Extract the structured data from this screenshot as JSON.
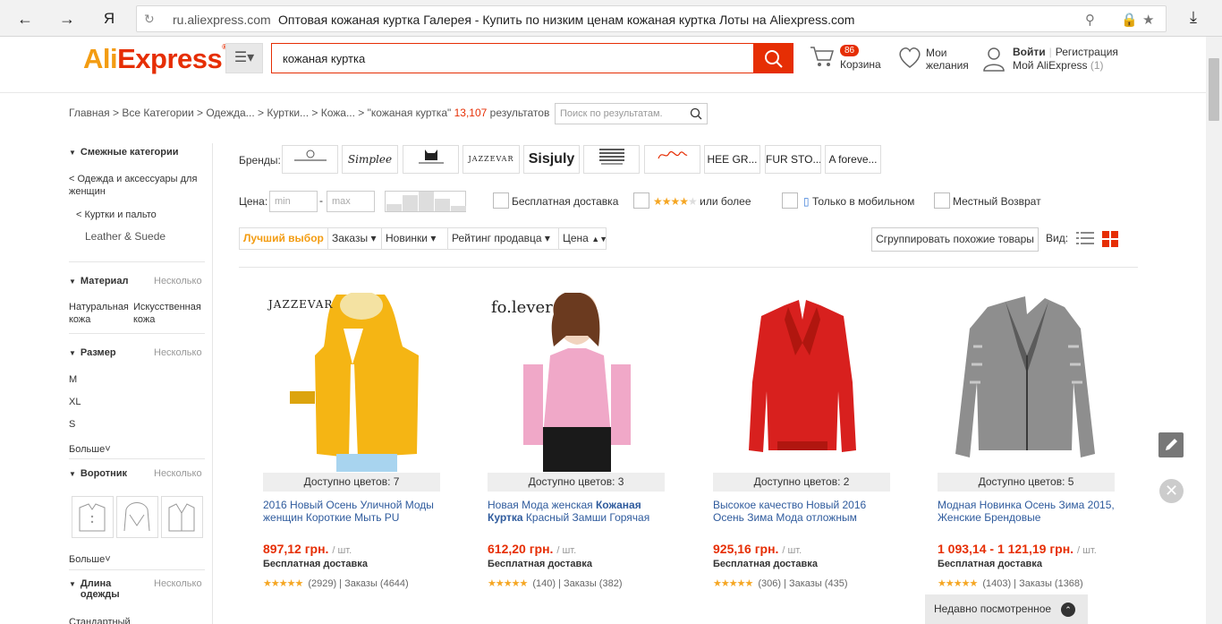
{
  "browser": {
    "domain": "ru.aliexpress.com",
    "title": "Оптовая кожаная куртка Галерея - Купить по низким ценам кожаная куртка Лоты на Aliexpress.com",
    "logo_letter": "Я"
  },
  "header": {
    "logo_ali": "Ali",
    "logo_express": "Express",
    "logo_tm": "®",
    "search_value": "кожаная куртка",
    "cart_count": "86",
    "cart_label": "Корзина",
    "wish_line1": "Мои",
    "wish_line2": "желания",
    "signin": "Войти",
    "register": "Регистрация",
    "my_account": "Мой AliExpress",
    "my_account_count": "(1)"
  },
  "breadcrumb": {
    "path": "Главная > Все Категории > Одежда... > Куртки... > Кожа... > \"кожаная куртка\"",
    "count": "13,107",
    "suffix": "результатов",
    "search_placeholder": "Поиск по результатам."
  },
  "sidebar": {
    "related_title": "Смежные категории",
    "cat1": "< Одежда и аксессуары для женщин",
    "cat2": "< Куртки и пальто",
    "cat3": "Leather & Suede",
    "material_title": "Материал",
    "material_sub": "Несколько",
    "material_opt1": "Натуральная кожа",
    "material_opt2": "Искусственная кожа",
    "size_title": "Размер",
    "size_sub": "Несколько",
    "sizes": [
      "M",
      "XL",
      "S"
    ],
    "more1": "Больше",
    "collar_title": "Воротник",
    "collar_sub": "Несколько",
    "more2": "Больше",
    "length_title": "Длина одежды",
    "length_sub": "Несколько",
    "length_opt1": "Стандартный"
  },
  "filters": {
    "brands_label": "Бренды:",
    "brands": [
      "",
      "Simplee",
      "",
      "JAZZEVAR",
      "Sisjuly",
      "",
      "",
      "HEE GR...",
      "FUR STO...",
      "A foreve..."
    ],
    "price_label": "Цена:",
    "price_min": "min",
    "price_max": "max",
    "dash": "-",
    "free_shipping": "Бесплатная доставка",
    "rating_or_more": "или более",
    "mobile_only": "Только в мобильном",
    "local_return": "Местный Возврат"
  },
  "sort": {
    "best": "Лучший выбор",
    "orders": "Заказы",
    "new": "Новинки",
    "seller_rating": "Рейтинг продавца",
    "price": "Цена",
    "group": "Сгруппировать похожие товары",
    "view": "Вид:"
  },
  "products": [
    {
      "brand": "JAZZEVAR",
      "colors": "Доступно цветов: 7",
      "title": "2016 Новый Осень Уличной Моды женщин Короткие Мыть PU",
      "title_bold": "",
      "title_rest": "",
      "price": "897,12 грн.",
      "unit": "/ шт.",
      "shipping": "Бесплатная доставка",
      "reviews": "(2929)",
      "orders": "Заказы (4644)",
      "color": "#f5b514"
    },
    {
      "brand": "fo.lever",
      "colors": "Доступно цветов: 3",
      "title": "Новая Мода женская ",
      "title_bold": "Кожаная Куртка",
      "title_rest": " Красный Замши Горячая",
      "price": "612,20 грн.",
      "unit": "/ шт.",
      "shipping": "Бесплатная доставка",
      "reviews": "(140)",
      "orders": "Заказы (382)",
      "color": "#f0a8c8"
    },
    {
      "brand": "",
      "colors": "Доступно цветов: 2",
      "title": "Высокое качество Новый 2016 Осень Зима Мода отложным",
      "title_bold": "",
      "title_rest": "",
      "price": "925,16 грн.",
      "unit": "/ шт.",
      "shipping": "Бесплатная доставка",
      "reviews": "(306)",
      "orders": "Заказы (435)",
      "color": "#d8201e"
    },
    {
      "brand": "",
      "colors": "Доступно цветов: 5",
      "title": "Модная Новинка Осень Зима 2015, Женские Брендовые",
      "title_bold": "",
      "title_rest": "",
      "price": "1 093,14 - 1 121,19 грн.",
      "unit": "/ шт.",
      "shipping": "Бесплатная доставка",
      "reviews": "(1403)",
      "orders": "Заказы (1368)",
      "color": "#9a9a9a"
    }
  ],
  "floating": {
    "recent": "Недавно посмотренное"
  }
}
